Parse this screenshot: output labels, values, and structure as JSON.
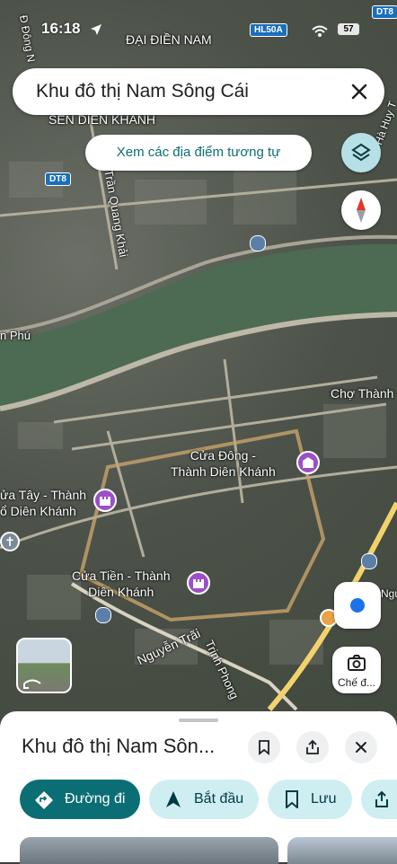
{
  "status_bar": {
    "time": "16:18",
    "battery": "57"
  },
  "search": {
    "query": "Khu đô thị Nam Sông Cái"
  },
  "similar_places": {
    "label": "Xem các địa điểm tương tự"
  },
  "map": {
    "labels": {
      "dai_dien_nam": "ĐẠI ĐIỀN NAM",
      "sen_dien_khanh": "SEN DIÊN KHÁNH",
      "tran_quang_khai": "Trần Quang Khải",
      "nguyen_trai": "Nguyễn Trãi",
      "trinh_phong": "Trịnh Phong",
      "cho_thanh": "Chợ Thành",
      "phu": "n Phú",
      "dong": "Đ Đông N",
      "huy": "Hà Huy T",
      "ngu": "Ngu"
    },
    "shields": {
      "hl50a": "HL50A",
      "dt8_top": "DT8",
      "dt8_left": "DT8"
    },
    "pois": {
      "cua_dong_line1": "Cửa Đông -",
      "cua_dong_line2": "Thành Diên Khánh",
      "cua_tay_line1": "ửa Tây - Thành",
      "cua_tay_line2": "ổ Diên Khánh",
      "cua_tien_line1": "Cửa Tiền - Thành",
      "cua_tien_line2": "Diên Khánh"
    },
    "colors": {
      "river": "#4d6a52",
      "road": "#bdb8a8",
      "highway": "#f2d36b",
      "poi": "#9c4fc7"
    }
  },
  "scan_button": {
    "label": "Chế đ..."
  },
  "sheet": {
    "title": "Khu đô thị Nam Sôn...",
    "actions": {
      "directions": "Đường đi",
      "start": "Bắt đầu",
      "save": "Lưu"
    }
  }
}
